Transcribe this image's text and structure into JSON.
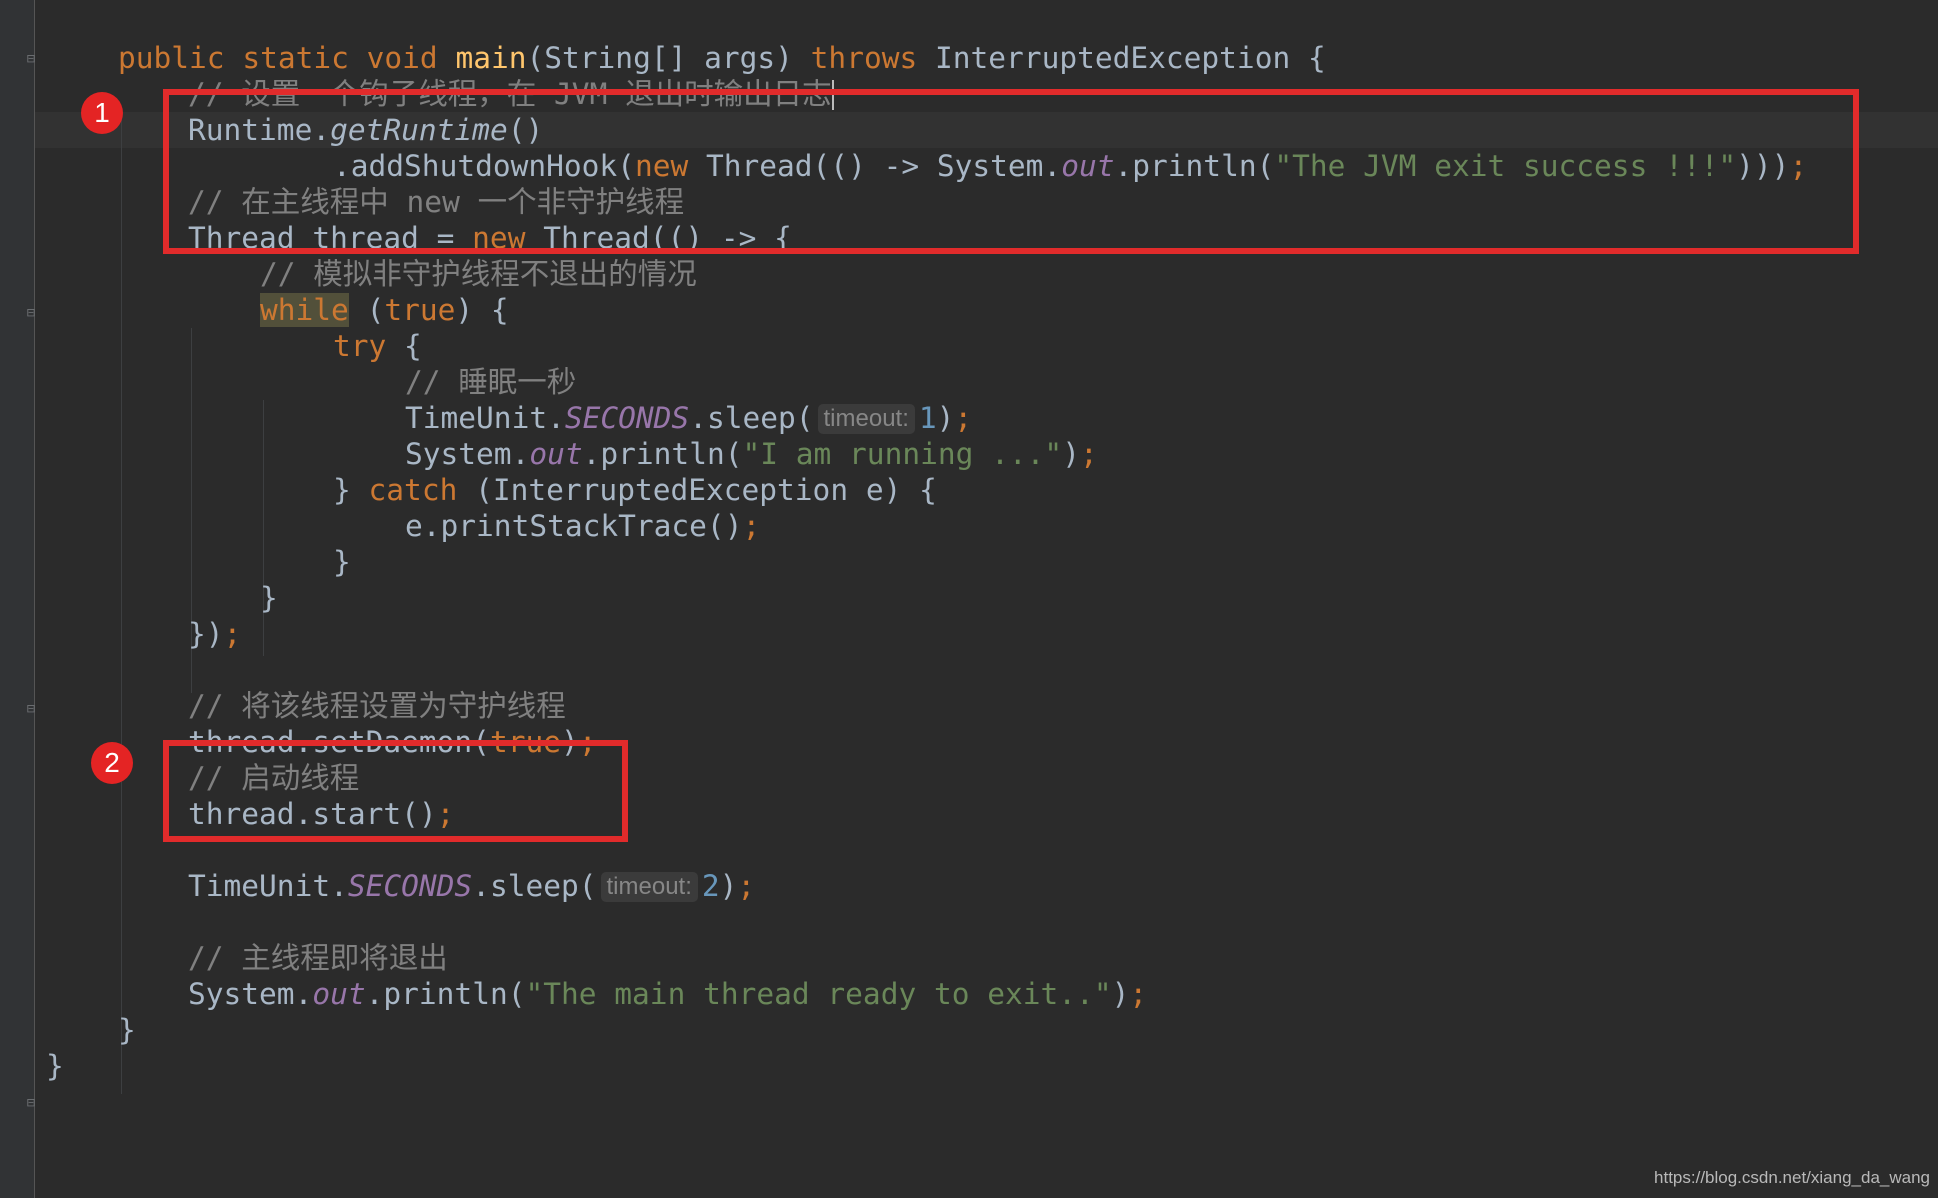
{
  "annotations": {
    "marker_1": "1",
    "marker_2": "2"
  },
  "watermark": "https://blog.csdn.net/xiang_da_wang",
  "colors": {
    "background": "#2b2b2b",
    "keyword": "#cc7832",
    "string": "#6a8759",
    "comment": "#808080",
    "static_field": "#9876aa",
    "number": "#6897bb",
    "highlight_box": "#e12b2b"
  },
  "code": {
    "l1": {
      "t1": "public static void ",
      "t2": "main",
      "t3": "(String[] args) ",
      "t4": "throws ",
      "t5": "InterruptedException {"
    },
    "l2": {
      "comment": "// 设置一个钩子线程，在 JVM 退出时输出日志"
    },
    "l3": {
      "t1": "Runtime.",
      "t2": "getRuntime",
      "t3": "()"
    },
    "l4": {
      "t1": ".addShutdownHook(",
      "t2": "new ",
      "t3": "Thread(() -> System.",
      "t4": "out",
      "t5": ".println(",
      "t6": "\"The JVM exit success !!!\"",
      "t7": ")))",
      "t8": ";"
    },
    "l5": {
      "comment": "// 在主线程中 new 一个非守护线程"
    },
    "l6": {
      "t1": "Thread thread = ",
      "t2": "new ",
      "t3": "Thread(() -> {"
    },
    "l7": {
      "comment": "// 模拟非守护线程不退出的情况"
    },
    "l8": {
      "t1": "while",
      "t2": " (",
      "t3": "true",
      "t4": ") {"
    },
    "l9": {
      "t1": "try ",
      "t2": "{"
    },
    "l10": {
      "comment": "// 睡眠一秒"
    },
    "l11": {
      "t1": "TimeUnit.",
      "t2": "SECONDS",
      "t3": ".sleep(",
      "hint": "timeout:",
      "t4": "1",
      "t5": ")",
      "t6": ";"
    },
    "l12": {
      "t1": "System.",
      "t2": "out",
      "t3": ".println(",
      "t4": "\"I am running ...\"",
      "t5": ")",
      "t6": ";"
    },
    "l13": {
      "t1": "} ",
      "t2": "catch ",
      "t3": "(InterruptedException e) {"
    },
    "l14": {
      "t1": "e.printStackTrace()",
      "t2": ";"
    },
    "l15": {
      "t1": "}"
    },
    "l16": {
      "t1": "}"
    },
    "l17": {
      "t1": "})",
      "t2": ";"
    },
    "l18": {
      "comment": "// 将该线程设置为守护线程"
    },
    "l19": {
      "t1": "thread.setDaemon(",
      "t2": "true",
      "t3": ")",
      "t4": ";"
    },
    "l20": {
      "comment": "// 启动线程"
    },
    "l21": {
      "t1": "thread.start()",
      "t2": ";"
    },
    "l22": {
      "t1": "TimeUnit.",
      "t2": "SECONDS",
      "t3": ".sleep(",
      "hint": "timeout:",
      "t4": "2",
      "t5": ")",
      "t6": ";"
    },
    "l23": {
      "comment": "// 主线程即将退出"
    },
    "l24": {
      "t1": "System.",
      "t2": "out",
      "t3": ".println(",
      "t4": "\"The main thread ready to exit..\"",
      "t5": ")",
      "t6": ";"
    },
    "l25": {
      "t1": "}"
    },
    "l26": {
      "t1": "}"
    }
  }
}
